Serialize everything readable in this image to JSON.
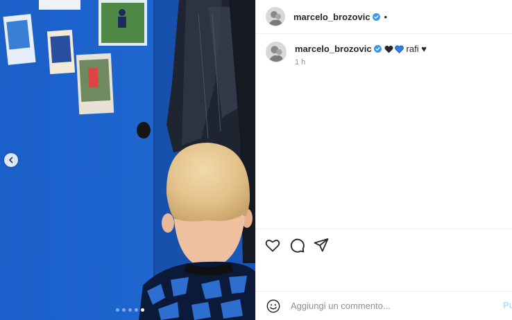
{
  "post": {
    "username": "marcelo_brozovic",
    "follow_separator": "•",
    "caption": "rafi ♥",
    "caption_hearts": [
      "black-heart",
      "blue-heart"
    ],
    "timestamp": "1 h",
    "image_description_icon": "photo",
    "carousel": {
      "count": 5,
      "active_index": 4
    }
  },
  "composer": {
    "placeholder": "Aggiungi un commento...",
    "post_label": "Pubblica"
  },
  "icons": {
    "like": "heart-icon",
    "comment": "comment-icon",
    "share": "send-icon",
    "emoji": "emoji-icon",
    "verified": "verified-badge-icon",
    "prev": "chevron-left-icon"
  },
  "colors": {
    "verified": "#3897f0",
    "link_disabled": "#b2dffc",
    "muted": "#8e8e8e",
    "wall_blue": "#1f5fc4"
  }
}
